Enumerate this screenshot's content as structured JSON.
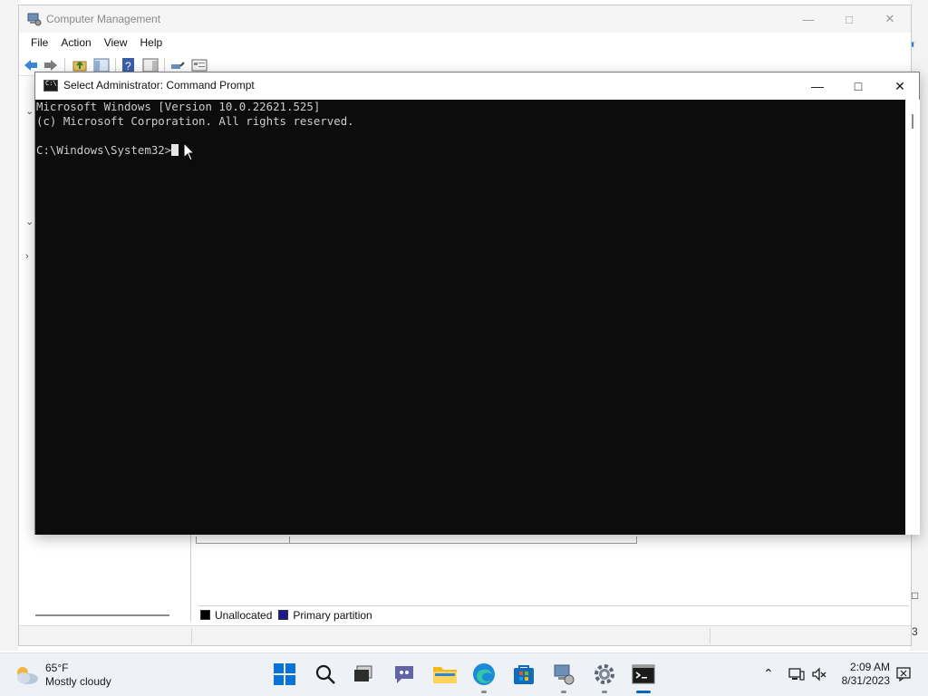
{
  "computer_management": {
    "title": "Computer Management",
    "menu": [
      "File",
      "Action",
      "View",
      "Help"
    ],
    "legend": [
      {
        "label": "Unallocated",
        "color": "#000000"
      },
      {
        "label": "Primary partition",
        "color": "#1a1a8c"
      }
    ],
    "edge_number": "3"
  },
  "command_prompt": {
    "title": "Select Administrator: Command Prompt",
    "lines": [
      "Microsoft Windows [Version 10.0.22621.525]",
      "(c) Microsoft Corporation. All rights reserved.",
      "",
      "C:\\Windows\\System32>"
    ]
  },
  "taskbar": {
    "weather_temp": "65°F",
    "weather_desc": "Mostly cloudy",
    "apps": [
      {
        "name": "start-button",
        "icon": "windows-logo-icon",
        "color": "#0067c0"
      },
      {
        "name": "search-button",
        "icon": "search-icon"
      },
      {
        "name": "task-view-button",
        "icon": "task-view-icon"
      },
      {
        "name": "chat-button",
        "icon": "teams-chat-icon",
        "color": "#5b5fc7"
      },
      {
        "name": "file-explorer-button",
        "icon": "folder-icon",
        "color": "#f6c342"
      },
      {
        "name": "edge-button",
        "icon": "edge-icon",
        "color": "#1c8ad8"
      },
      {
        "name": "store-button",
        "icon": "store-icon",
        "color": "#0f6cbd"
      },
      {
        "name": "computer-management-taskbar-button",
        "icon": "computer-management-icon"
      },
      {
        "name": "settings-button",
        "icon": "gear-icon"
      },
      {
        "name": "command-prompt-taskbar-button",
        "icon": "terminal-icon"
      }
    ],
    "time": "2:09 AM",
    "date": "8/31/2023"
  }
}
